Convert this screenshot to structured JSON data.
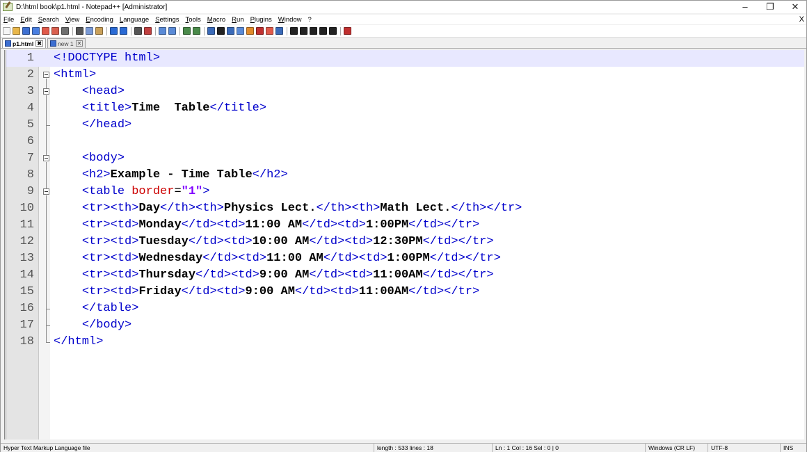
{
  "window": {
    "title": "D:\\html book\\p1.html - Notepad++ [Administrator]",
    "controls": {
      "minimize": "–",
      "maximize": "❐",
      "close": "✕"
    }
  },
  "menu": {
    "items": [
      "File",
      "Edit",
      "Search",
      "View",
      "Encoding",
      "Language",
      "Settings",
      "Tools",
      "Macro",
      "Run",
      "Plugins",
      "Window",
      "?"
    ],
    "close_glyph": "X"
  },
  "toolbar": {
    "buttons": [
      {
        "icon": "new-file-icon",
        "color": "#f5f5f5"
      },
      {
        "icon": "open-file-icon",
        "color": "#e8b64a"
      },
      {
        "icon": "save-icon",
        "color": "#3d6fd1"
      },
      {
        "icon": "save-all-icon",
        "color": "#4a7fe0"
      },
      {
        "icon": "close-icon",
        "color": "#e05a4a"
      },
      {
        "icon": "close-all-icon",
        "color": "#d9604f"
      },
      {
        "icon": "print-icon",
        "color": "#6f6f6f"
      },
      {
        "sep": true
      },
      {
        "icon": "cut-icon",
        "color": "#555"
      },
      {
        "icon": "copy-icon",
        "color": "#7a9ad6"
      },
      {
        "icon": "paste-icon",
        "color": "#c9a05a"
      },
      {
        "sep": true
      },
      {
        "icon": "undo-icon",
        "color": "#2a6ad4"
      },
      {
        "icon": "redo-icon",
        "color": "#2a6ad4"
      },
      {
        "sep": true
      },
      {
        "icon": "find-icon",
        "color": "#555"
      },
      {
        "icon": "replace-icon",
        "color": "#c04040"
      },
      {
        "sep": true
      },
      {
        "icon": "zoom-in-icon",
        "color": "#5a8ad6"
      },
      {
        "icon": "zoom-out-icon",
        "color": "#5a8ad6"
      },
      {
        "sep": true
      },
      {
        "icon": "sync-v-icon",
        "color": "#4a8a4a"
      },
      {
        "icon": "sync-h-icon",
        "color": "#4a8a4a"
      },
      {
        "sep": true
      },
      {
        "icon": "word-wrap-icon",
        "color": "#3a6ab8"
      },
      {
        "icon": "all-chars-icon",
        "color": "#222"
      },
      {
        "icon": "indent-guide-icon",
        "color": "#3a6ab8"
      },
      {
        "icon": "udl-icon",
        "color": "#5a8ad6"
      },
      {
        "icon": "doc-map-icon",
        "color": "#e08a2a"
      },
      {
        "icon": "function-list-icon",
        "color": "#c03030"
      },
      {
        "icon": "folder-workspace-icon",
        "color": "#e05a4a"
      },
      {
        "icon": "monitor-icon",
        "color": "#3a6ab8"
      },
      {
        "sep": true
      },
      {
        "icon": "record-macro-icon",
        "color": "#222"
      },
      {
        "icon": "stop-macro-icon",
        "color": "#222"
      },
      {
        "icon": "play-macro-icon",
        "color": "#222"
      },
      {
        "icon": "run-macro-multiple-icon",
        "color": "#222"
      },
      {
        "icon": "save-macro-icon",
        "color": "#222"
      },
      {
        "sep": true
      },
      {
        "icon": "spell-check-icon",
        "color": "#c03030"
      }
    ]
  },
  "tabs": [
    {
      "label": "p1.html",
      "active": true,
      "close": "✖"
    },
    {
      "label": "new 1",
      "active": false,
      "close": "✕"
    }
  ],
  "editor": {
    "current_line": 1,
    "lines": [
      {
        "n": "1",
        "fold": "",
        "segs": [
          [
            "t",
            "<!DOCTYPE html>"
          ]
        ]
      },
      {
        "n": "2",
        "fold": "box",
        "indent": 0,
        "segs": [
          [
            "t",
            "<html>"
          ]
        ]
      },
      {
        "n": "3",
        "fold": "box",
        "indent": 1,
        "segs": [
          [
            "t",
            "<head>"
          ]
        ]
      },
      {
        "n": "4",
        "fold": "line",
        "indent": 1,
        "segs": [
          [
            "t",
            "<title>"
          ],
          [
            "b",
            "Time  Table"
          ],
          [
            "t",
            "</title>"
          ]
        ]
      },
      {
        "n": "5",
        "fold": "end",
        "indent": 1,
        "segs": [
          [
            "t",
            "</head>"
          ]
        ]
      },
      {
        "n": "6",
        "fold": "line",
        "indent": 0,
        "segs": []
      },
      {
        "n": "7",
        "fold": "box",
        "indent": 1,
        "segs": [
          [
            "t",
            "<body>"
          ]
        ]
      },
      {
        "n": "8",
        "fold": "line",
        "indent": 1,
        "segs": [
          [
            "t",
            "<h2>"
          ],
          [
            "b",
            "Example - Time Table"
          ],
          [
            "t",
            "</h2>"
          ]
        ]
      },
      {
        "n": "9",
        "fold": "box",
        "indent": 1,
        "segs": [
          [
            "t",
            "<table "
          ],
          [
            "a",
            "border"
          ],
          [
            "p",
            "="
          ],
          [
            "v",
            "\"1\""
          ],
          [
            "t",
            ">"
          ]
        ]
      },
      {
        "n": "10",
        "fold": "line",
        "indent": 1,
        "segs": [
          [
            "t",
            "<tr><th>"
          ],
          [
            "b",
            "Day"
          ],
          [
            "t",
            "</th><th>"
          ],
          [
            "b",
            "Physics Lect."
          ],
          [
            "t",
            "</th><th>"
          ],
          [
            "b",
            "Math Lect."
          ],
          [
            "t",
            "</th></tr>"
          ]
        ]
      },
      {
        "n": "11",
        "fold": "line",
        "indent": 1,
        "segs": [
          [
            "t",
            "<tr><td>"
          ],
          [
            "b",
            "Monday"
          ],
          [
            "t",
            "</td><td>"
          ],
          [
            "b",
            "11:00 AM"
          ],
          [
            "t",
            "</td><td>"
          ],
          [
            "b",
            "1:00PM"
          ],
          [
            "t",
            "</td></tr>"
          ]
        ]
      },
      {
        "n": "12",
        "fold": "line",
        "indent": 1,
        "segs": [
          [
            "t",
            "<tr><td>"
          ],
          [
            "b",
            "Tuesday"
          ],
          [
            "t",
            "</td><td>"
          ],
          [
            "b",
            "10:00 AM"
          ],
          [
            "t",
            "</td><td>"
          ],
          [
            "b",
            "12:30PM"
          ],
          [
            "t",
            "</td></tr>"
          ]
        ]
      },
      {
        "n": "13",
        "fold": "line",
        "indent": 1,
        "segs": [
          [
            "t",
            "<tr><td>"
          ],
          [
            "b",
            "Wednesday"
          ],
          [
            "t",
            "</td><td>"
          ],
          [
            "b",
            "11:00 AM"
          ],
          [
            "t",
            "</td><td>"
          ],
          [
            "b",
            "1:00PM"
          ],
          [
            "t",
            "</td></tr>"
          ]
        ]
      },
      {
        "n": "14",
        "fold": "line",
        "indent": 1,
        "segs": [
          [
            "t",
            "<tr><td>"
          ],
          [
            "b",
            "Thursday"
          ],
          [
            "t",
            "</td><td>"
          ],
          [
            "b",
            "9:00 AM"
          ],
          [
            "t",
            "</td><td>"
          ],
          [
            "b",
            "11:00AM"
          ],
          [
            "t",
            "</td></tr>"
          ]
        ]
      },
      {
        "n": "15",
        "fold": "line",
        "indent": 1,
        "segs": [
          [
            "t",
            "<tr><td>"
          ],
          [
            "b",
            "Friday"
          ],
          [
            "t",
            "</td><td>"
          ],
          [
            "b",
            "9:00 AM"
          ],
          [
            "t",
            "</td><td>"
          ],
          [
            "b",
            "11:00AM"
          ],
          [
            "t",
            "</td></tr>"
          ]
        ]
      },
      {
        "n": "16",
        "fold": "end",
        "indent": 1,
        "segs": [
          [
            "t",
            "</table>"
          ]
        ]
      },
      {
        "n": "17",
        "fold": "end",
        "indent": 1,
        "segs": [
          [
            "t",
            "</body>"
          ]
        ]
      },
      {
        "n": "18",
        "fold": "endlast",
        "indent": 0,
        "segs": [
          [
            "t",
            "</html>"
          ]
        ]
      }
    ]
  },
  "status": {
    "file_type": "Hyper Text Markup Language file",
    "length": "length : 533   lines : 18",
    "position": "Ln : 1    Col : 16    Sel : 0 | 0",
    "eol": "Windows (CR LF)",
    "encoding": "UTF-8",
    "mode": "INS"
  }
}
